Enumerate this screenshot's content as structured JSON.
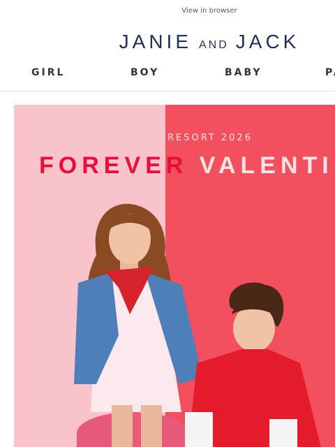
{
  "header": {
    "view_in_browser": "View in browser",
    "logo_main_1": "JANIE",
    "logo_small": "AND",
    "logo_main_2": "JACK"
  },
  "nav": {
    "items": [
      {
        "label": "GIRL"
      },
      {
        "label": "BOY"
      },
      {
        "label": "BABY"
      },
      {
        "label": "PA"
      }
    ]
  },
  "hero": {
    "season": "RESORT 2026",
    "headline": "FOREVER VALENTI",
    "colors": {
      "left_bg": "#f8c3cb",
      "right_bg": "#f2505f",
      "headline_left": "#e8103a",
      "headline_right": "#fde2e6",
      "season": "#fde2e6"
    }
  }
}
